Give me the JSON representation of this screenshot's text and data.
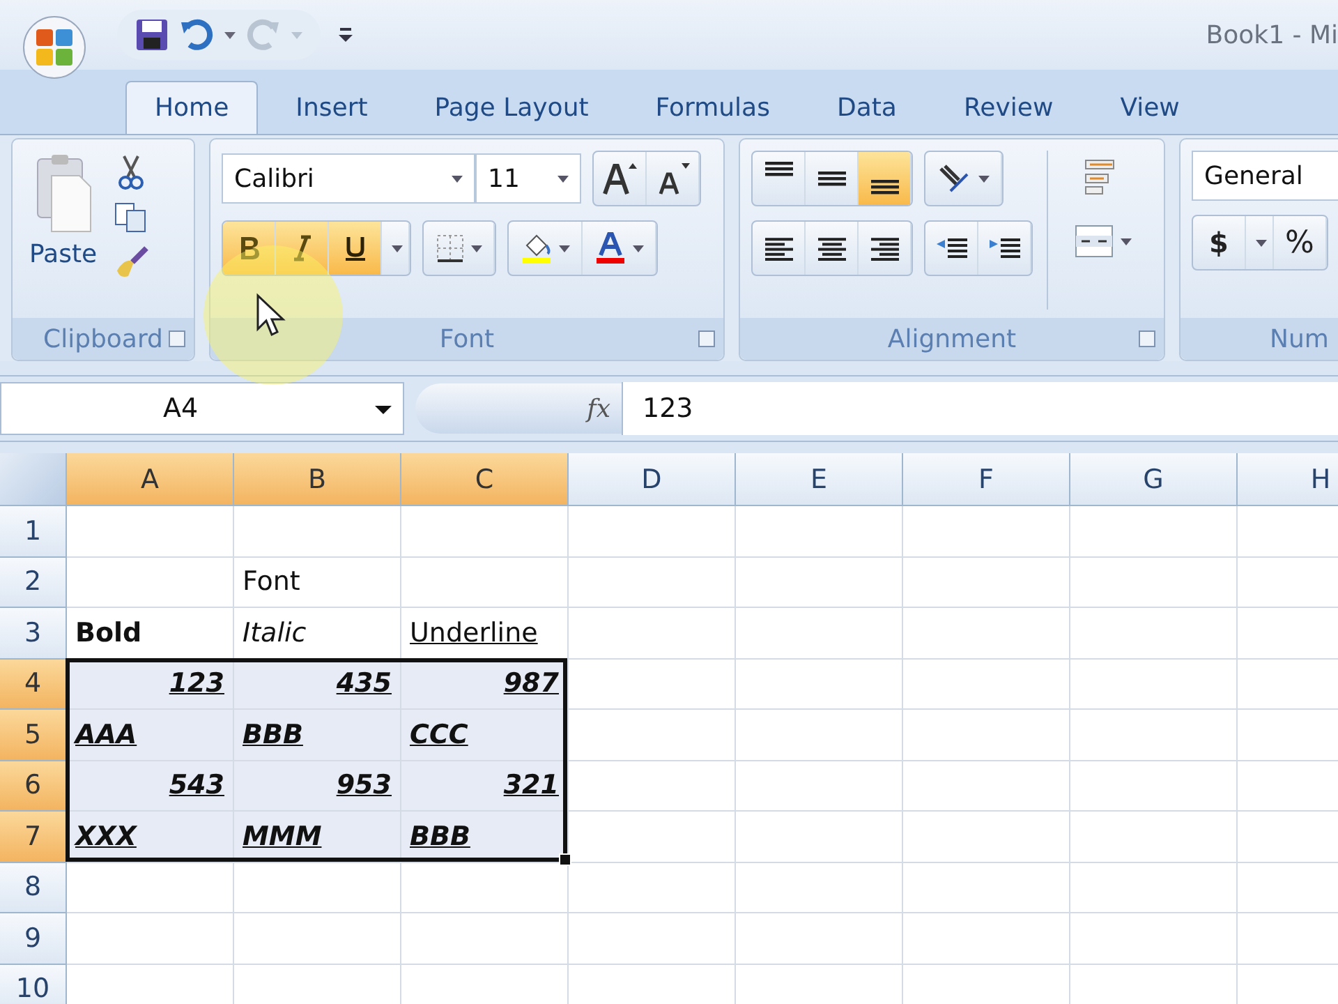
{
  "window": {
    "title": "Book1 - Mi"
  },
  "tabs": [
    {
      "label": "Home",
      "selected": true
    },
    {
      "label": "Insert",
      "selected": false
    },
    {
      "label": "Page Layout",
      "selected": false
    },
    {
      "label": "Formulas",
      "selected": false
    },
    {
      "label": "Data",
      "selected": false
    },
    {
      "label": "Review",
      "selected": false
    },
    {
      "label": "View",
      "selected": false
    }
  ],
  "ribbon": {
    "clipboard": {
      "paste": "Paste",
      "label": "Clipboard"
    },
    "font": {
      "family": "Calibri",
      "size": "11",
      "bold": true,
      "italic": true,
      "underline": true,
      "label": "Font"
    },
    "alignment": {
      "vertical": [
        {
          "selected": false
        },
        {
          "selected": false
        },
        {
          "selected": true
        }
      ],
      "label": "Alignment"
    },
    "number": {
      "format": "General",
      "currency": "$",
      "percent": "%",
      "label": "Num"
    }
  },
  "formula_bar": {
    "name_box": "A4",
    "fx": "fx",
    "value": "123"
  },
  "sheet": {
    "columns": [
      {
        "label": "A",
        "selected": true
      },
      {
        "label": "B",
        "selected": true
      },
      {
        "label": "C",
        "selected": true
      },
      {
        "label": "D",
        "selected": false
      },
      {
        "label": "E",
        "selected": false
      },
      {
        "label": "F",
        "selected": false
      },
      {
        "label": "G",
        "selected": false
      },
      {
        "label": "H",
        "selected": false
      }
    ],
    "rows": [
      {
        "number": "1",
        "selected": false,
        "cells": []
      },
      {
        "number": "2",
        "selected": false,
        "cells": [
          {},
          {
            "text": "Font"
          }
        ]
      },
      {
        "number": "3",
        "selected": false,
        "cells": [
          {
            "text": "Bold",
            "bold": true
          },
          {
            "text": "Italic",
            "italic": true
          },
          {
            "text": "Underline",
            "underline": true
          }
        ]
      },
      {
        "number": "4",
        "selected": true,
        "cells": [
          {
            "text": "123",
            "bold": true,
            "italic": true,
            "underline": true,
            "right_aligned": true
          },
          {
            "text": "435",
            "bold": true,
            "italic": true,
            "underline": true,
            "right_aligned": true
          },
          {
            "text": "987",
            "bold": true,
            "italic": true,
            "underline": true,
            "right_aligned": true
          }
        ]
      },
      {
        "number": "5",
        "selected": true,
        "cells": [
          {
            "text": "AAA",
            "bold": true,
            "italic": true,
            "underline": true
          },
          {
            "text": "BBB",
            "bold": true,
            "italic": true,
            "underline": true
          },
          {
            "text": "CCC",
            "bold": true,
            "italic": true,
            "underline": true
          }
        ]
      },
      {
        "number": "6",
        "selected": true,
        "cells": [
          {
            "text": "543",
            "bold": true,
            "italic": true,
            "underline": true,
            "right_aligned": true
          },
          {
            "text": "953",
            "bold": true,
            "italic": true,
            "underline": true,
            "right_aligned": true
          },
          {
            "text": "321",
            "bold": true,
            "italic": true,
            "underline": true,
            "right_aligned": true
          }
        ]
      },
      {
        "number": "7",
        "selected": true,
        "cells": [
          {
            "text": "XXX",
            "bold": true,
            "italic": true,
            "underline": true
          },
          {
            "text": "MMM",
            "bold": true,
            "italic": true,
            "underline": true
          },
          {
            "text": "BBB",
            "bold": true,
            "italic": true,
            "underline": true
          }
        ]
      },
      {
        "number": "8",
        "selected": false,
        "cells": []
      },
      {
        "number": "9",
        "selected": false,
        "cells": []
      },
      {
        "number": "10",
        "selected": false,
        "cells": []
      }
    ]
  }
}
